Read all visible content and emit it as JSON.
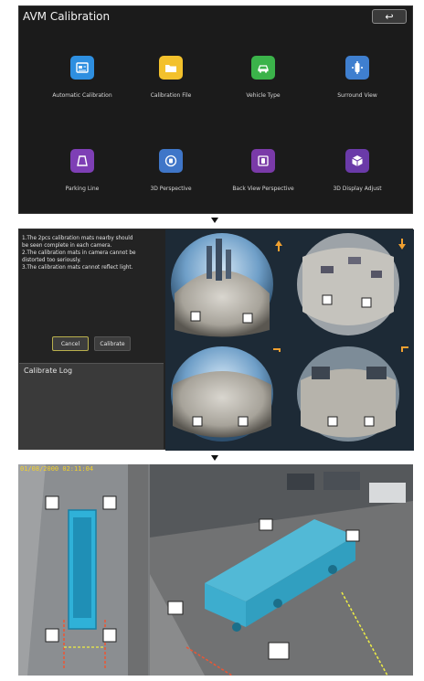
{
  "screen1": {
    "title": "AVM Calibration",
    "back_glyph": "↩",
    "tiles": [
      {
        "label": "Automatic Calibration",
        "icon": "auto-calibration-icon",
        "color": "#2e8fe0"
      },
      {
        "label": "Calibration File",
        "icon": "folder-icon",
        "color": "#f3c12c"
      },
      {
        "label": "Vehicle Type",
        "icon": "car-icon",
        "color": "#3bb34a"
      },
      {
        "label": "Surround View",
        "icon": "surround-view-icon",
        "color": "#3f7fcf"
      },
      {
        "label": "Parking Line",
        "icon": "parking-line-icon",
        "color": "#7e3fb5"
      },
      {
        "label": "3D Perspective",
        "icon": "3d-perspective-icon",
        "color": "#3f76c8"
      },
      {
        "label": "Back View Perspective",
        "icon": "back-view-icon",
        "color": "#7a3aa8"
      },
      {
        "label": "3D Display Adjust",
        "icon": "cube-icon",
        "color": "#6a3aa8"
      }
    ]
  },
  "screen2": {
    "instructions": [
      "1.The 2pcs calibration mats nearby should",
      "be seen complete in each camera.",
      "2.The calibration mats in camera cannot be",
      "distorted too seriously.",
      "3.The calibration mats cannot reflect light."
    ],
    "cancel_label": "Cancel",
    "calibrate_label": "Calibrate",
    "log_title": "Calibrate Log"
  },
  "screen3": {
    "timestamp": "01/08/2000 02:11:04"
  }
}
